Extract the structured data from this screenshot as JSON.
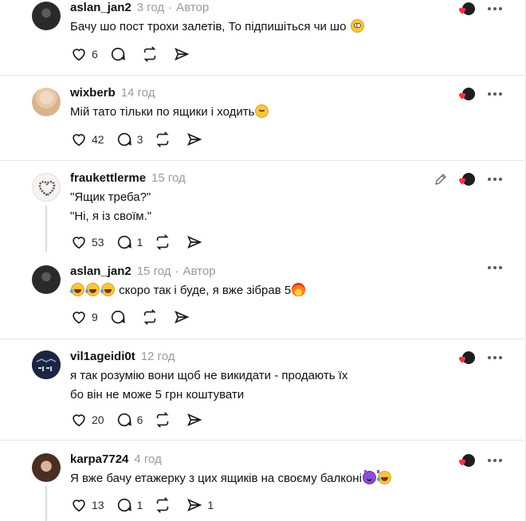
{
  "posts": [
    {
      "username": "aslan_jan2",
      "time": "3 год",
      "author_tag": "Автор",
      "lines": [
        "Бачу шо пост трохи залетів, То підпишіться чи шо"
      ],
      "likes": "6",
      "replies": "",
      "sends": ""
    },
    {
      "username": "wixberb",
      "time": "14 год",
      "author_tag": "",
      "lines": [
        "Мій тато тільки по ящики і ходить"
      ],
      "likes": "42",
      "replies": "3",
      "sends": ""
    },
    {
      "username": "fraukettlerme",
      "time": "15 год",
      "author_tag": "",
      "lines": [
        "\"Ящик треба?\"",
        "\"Ні, я із своїм.\""
      ],
      "likes": "53",
      "replies": "1",
      "sends": ""
    },
    {
      "username": "aslan_jan2",
      "time": "15 год",
      "author_tag": "Автор",
      "lines": [
        "скоро так і буде, я вже зібрав 5"
      ],
      "likes": "9",
      "replies": "",
      "sends": ""
    },
    {
      "username": "vil1ageidi0t",
      "time": "12 год",
      "author_tag": "",
      "lines": [
        "я так розумію вони щоб не викидати - продають їх",
        "бо він не може 5 грн коштувати"
      ],
      "likes": "20",
      "replies": "6",
      "sends": ""
    },
    {
      "username": "karpa7724",
      "time": "4 год",
      "author_tag": "",
      "lines": [
        "Я вже бачу етажерку з цих ящиків на своєму балконі"
      ],
      "likes": "13",
      "replies": "1",
      "sends": "1"
    }
  ],
  "separator": "·",
  "icons": {
    "like": "heart-icon",
    "reply": "comment-bubble-icon",
    "repost": "repost-icon",
    "share": "send-icon",
    "more": "more-dots-icon",
    "edit": "pencil-icon"
  },
  "colors": {
    "text": "#101010",
    "muted": "#9a9a9a",
    "like_red": "#ff3040",
    "divider": "#e4e4e4"
  }
}
